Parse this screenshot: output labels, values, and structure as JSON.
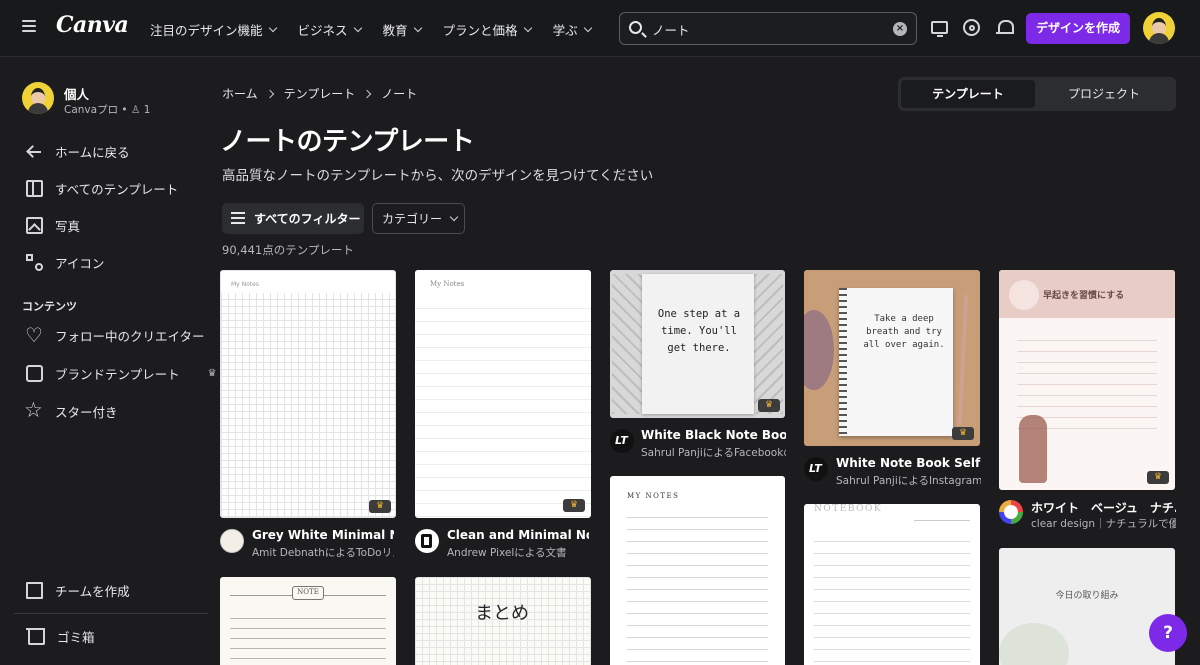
{
  "header": {
    "logo": "Canva",
    "nav": [
      "注目のデザイン機能",
      "ビジネス",
      "教育",
      "プランと価格",
      "学ぶ"
    ],
    "search_value": "ノート",
    "create_label": "デザインを作成"
  },
  "sidebar": {
    "account_name": "個人",
    "account_sub": "Canvaプロ • ♙ 1",
    "items": [
      {
        "label": "ホームに戻る"
      },
      {
        "label": "すべてのテンプレート"
      },
      {
        "label": "写真"
      },
      {
        "label": "アイコン"
      }
    ],
    "section_label": "コンテンツ",
    "content_items": [
      {
        "label": "フォロー中のクリエイター"
      },
      {
        "label": "ブランドテンプレート"
      },
      {
        "label": "スター付き"
      }
    ],
    "bottom_items": [
      {
        "label": "チームを作成"
      },
      {
        "label": "ゴミ箱"
      }
    ]
  },
  "main": {
    "breadcrumb": [
      "ホーム",
      "テンプレート",
      "ノート"
    ],
    "tabs": [
      "テンプレート",
      "プロジェクト"
    ],
    "title": "ノートのテンプレート",
    "subtitle": "高品質なノートのテンプレートから、次のデザインを見つけてください",
    "filter_label": "すべてのフィルター",
    "category_label": "カテゴリー",
    "count_text": "90,441点のテンプレート"
  },
  "cards": [
    {
      "title": "Grey White Minimal Note...",
      "author": "Amit DebnathによるToDoリス...",
      "thumb_text": "My Notes"
    },
    {
      "title": "Clean and Minimal Note ...",
      "author": "Andrew Pixelによる文書",
      "thumb_text": "My Notes"
    },
    {
      "title": "White Black Note Book R...",
      "author": "Sahrul PanjiによるFacebookの...",
      "thumb_text": "One step at a time. You'll get there."
    },
    {
      "title": "White Note Book Self Re...",
      "author": "Sahrul PanjiによるInstagram...",
      "thumb_text": "Take a deep breath and try all over again."
    },
    {
      "title": "ホワイト　ベージュ　ナチ...",
      "author": "clear design｜ナチュラルで優...",
      "thumb_text": "早起きを習慣にする"
    }
  ],
  "lower_cards": [
    {
      "thumb_text": "NOTE"
    },
    {
      "thumb_text": "まとめ"
    },
    {
      "thumb_text": "MY NOTES"
    },
    {
      "thumb_text": "NOTEBOOK"
    },
    {
      "thumb_text": "今日の取り組み"
    }
  ],
  "help_label": "?",
  "colors": {
    "accent": "#7d2ae8",
    "background": "#1c1c1e",
    "crown": "#f3b731"
  }
}
